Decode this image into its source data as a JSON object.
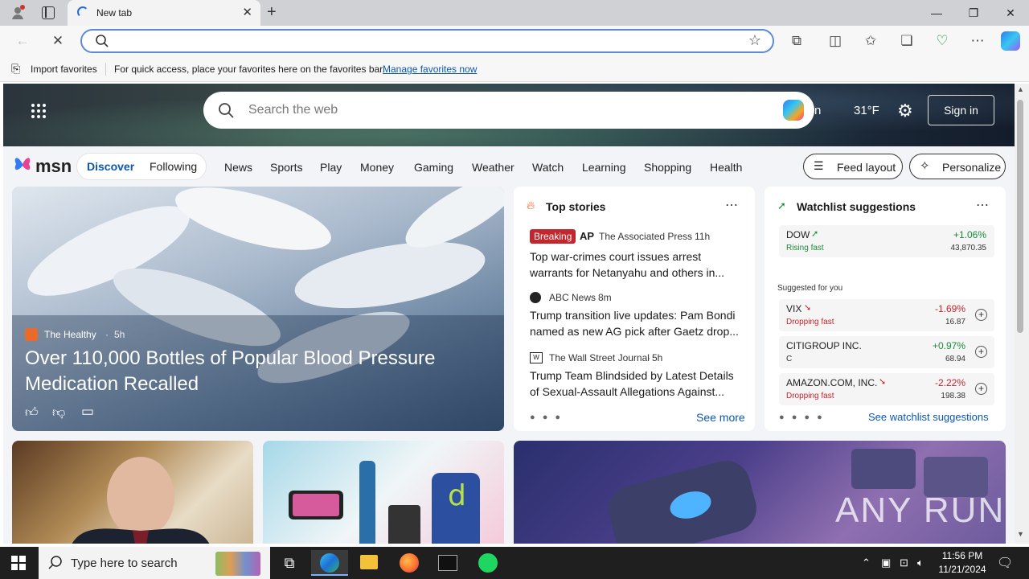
{
  "browser": {
    "tab_title": "New tab",
    "address_value": "",
    "favorites_import": "Import favorites",
    "favorites_hint": "For quick access, place your favorites here on the favorites bar.",
    "favorites_manage": "Manage favorites now"
  },
  "msn": {
    "search_placeholder": "Search the web",
    "partial_text": "n",
    "temperature": "31°F",
    "signin": "Sign in",
    "logo": "msn",
    "tabs": [
      "Discover",
      "Following"
    ],
    "nav": [
      "News",
      "Sports",
      "Play",
      "Money",
      "Gaming",
      "Weather",
      "Watch",
      "Learning",
      "Shopping",
      "Health"
    ],
    "feed_layout": "Feed layout",
    "personalize": "Personalize",
    "hero": {
      "source": "The Healthy",
      "age": "5h",
      "headline": "Over 110,000 Bottles of Popular Blood Pressure Medication Recalled"
    },
    "top_stories": {
      "title": "Top stories",
      "breaking": "Breaking",
      "items": [
        {
          "source": "The Associated Press",
          "age": "11h",
          "headline_line1": "Top war-crimes court issues arrest",
          "headline_line2": "warrants for Netanyahu and others in..."
        },
        {
          "source": "ABC News",
          "age": "8m",
          "headline_line1": "Trump transition live updates: Pam Bondi",
          "headline_line2": "named as new AG pick after Gaetz drop..."
        },
        {
          "source": "The Wall Street Journal",
          "age": "5h",
          "headline_line1": "Trump Team Blindsided by Latest Details",
          "headline_line2": "of Sexual-Assault Allegations Against..."
        }
      ],
      "see_more": "See more"
    },
    "watchlist": {
      "title": "Watchlist suggestions",
      "suggested_label": "Suggested for you",
      "see_link": "See watchlist suggestions",
      "stocks": [
        {
          "name": "DOW",
          "status": "Rising fast",
          "change": "+1.06%",
          "value": "43,870.35",
          "up": true
        },
        {
          "name": "VIX",
          "status": "Dropping fast",
          "change": "-1.69%",
          "value": "16.87",
          "up": false
        },
        {
          "name": "CITIGROUP INC.",
          "status": "C",
          "change": "+0.97%",
          "value": "68.94",
          "up": true
        },
        {
          "name": "AMAZON.COM, INC.",
          "status": "Dropping fast",
          "change": "-2.22%",
          "value": "198.38",
          "up": false
        }
      ]
    },
    "watermark": "ANY RUN"
  },
  "taskbar": {
    "search_placeholder": "Type here to search",
    "time": "11:56 PM",
    "date": "11/21/2024"
  },
  "colors": {
    "accent": "#0b57b0",
    "up": "#1b8a3a",
    "down": "#c4262e",
    "breaking": "#c4262e"
  }
}
